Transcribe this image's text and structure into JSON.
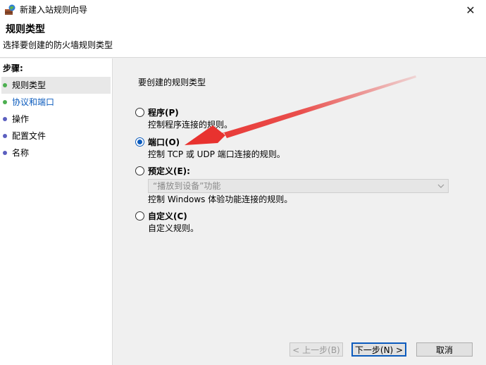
{
  "window": {
    "title": "新建入站规则向导",
    "close_glyph": "✕"
  },
  "header": {
    "title": "规则类型",
    "subtitle": "选择要创建的防火墙规则类型"
  },
  "sidebar": {
    "steps_label": "步骤:",
    "items": [
      {
        "label": "规则类型"
      },
      {
        "label": "协议和端口"
      },
      {
        "label": "操作"
      },
      {
        "label": "配置文件"
      },
      {
        "label": "名称"
      }
    ]
  },
  "main": {
    "question": "要创建的规则类型",
    "options": [
      {
        "label": "程序(P)",
        "desc": "控制程序连接的规则。",
        "selected": false
      },
      {
        "label": "端口(O)",
        "desc": "控制 TCP 或 UDP 端口连接的规则。",
        "selected": true
      },
      {
        "label": "预定义(E):",
        "desc": "控制 Windows 体验功能连接的规则。",
        "selected": false
      },
      {
        "label": "自定义(C)",
        "desc": "自定义规则。",
        "selected": false
      }
    ],
    "predefined_select_value": "“播放到设备”功能"
  },
  "buttons": {
    "back": "< 上一步(B)",
    "next": "下一步(N) >",
    "cancel": "取消"
  },
  "colors": {
    "accent": "#0b5bbd",
    "annotation_arrow": "#e8322f",
    "step_dot_done": "#4caf50",
    "step_dot_pending": "#5b5fbf"
  }
}
